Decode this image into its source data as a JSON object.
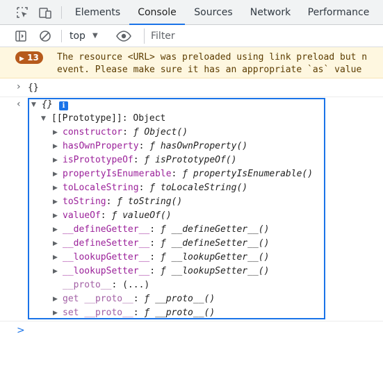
{
  "tabs": [
    {
      "label": "Elements"
    },
    {
      "label": "Console"
    },
    {
      "label": "Sources"
    },
    {
      "label": "Network"
    },
    {
      "label": "Performance"
    }
  ],
  "toolbar": {
    "context": "top",
    "filter_placeholder": "Filter"
  },
  "warning": {
    "count": "13",
    "line1": "The resource <URL> was preloaded using link preload but n",
    "line2": "event. Please make sure it has an appropriate `as` value"
  },
  "input_echo": "{}",
  "result": {
    "summary": "{}",
    "info": "i",
    "prototype_label": "[[Prototype]]: Object",
    "props": [
      {
        "key": "constructor",
        "sep": ": ",
        "f": "ƒ ",
        "val": "Object()"
      },
      {
        "key": "hasOwnProperty",
        "sep": ": ",
        "f": "ƒ ",
        "val": "hasOwnProperty()"
      },
      {
        "key": "isPrototypeOf",
        "sep": ": ",
        "f": "ƒ ",
        "val": "isPrototypeOf()"
      },
      {
        "key": "propertyIsEnumerable",
        "sep": ": ",
        "f": "ƒ ",
        "val": "propertyIsEnumerable()"
      },
      {
        "key": "toLocaleString",
        "sep": ": ",
        "f": "ƒ ",
        "val": "toLocaleString()"
      },
      {
        "key": "toString",
        "sep": ": ",
        "f": "ƒ ",
        "val": "toString()"
      },
      {
        "key": "valueOf",
        "sep": ": ",
        "f": "ƒ ",
        "val": "valueOf()"
      },
      {
        "key": "__defineGetter__",
        "sep": ": ",
        "f": "ƒ ",
        "val": "__defineGetter__()"
      },
      {
        "key": "__defineSetter__",
        "sep": ": ",
        "f": "ƒ ",
        "val": "__defineSetter__()"
      },
      {
        "key": "__lookupGetter__",
        "sep": ": ",
        "f": "ƒ ",
        "val": "__lookupGetter__()"
      },
      {
        "key": "__lookupSetter__",
        "sep": ": ",
        "f": "ƒ ",
        "val": "__lookupSetter__()"
      }
    ],
    "proto_key": "__proto__",
    "proto_val": ": (...)",
    "getter_prefix": "get ",
    "setter_prefix": "set ",
    "accessor_key": "__proto__",
    "accessor_sep": ": ",
    "accessor_f": "ƒ ",
    "accessor_val": "__proto__()"
  },
  "prompt": ">"
}
